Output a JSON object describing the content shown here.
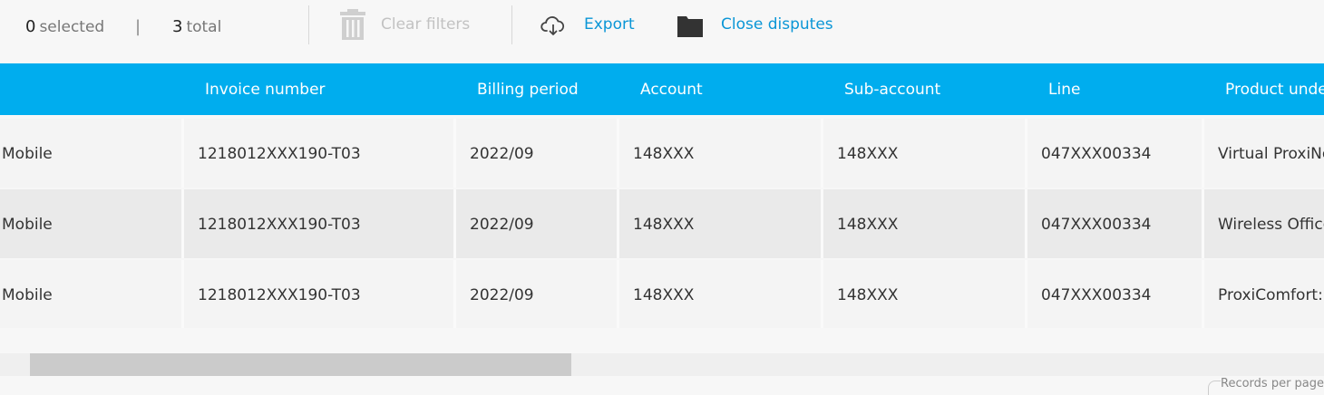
{
  "toolbar": {
    "selected_count": "0",
    "selected_label": "selected",
    "separator": "|",
    "total_count": "3",
    "total_label": "total",
    "clear_filters_label": "Clear filters",
    "export_label": "Export",
    "close_disputes_label": "Close disputes",
    "icons": {
      "clear": "trash-icon",
      "export": "cloud-download-icon",
      "close": "folder-icon"
    }
  },
  "table": {
    "columns": [
      "",
      "Invoice number",
      "Billing period",
      "Account",
      "Sub-account",
      "Line",
      "Product unde"
    ],
    "rows": [
      [
        "Mobile",
        "1218012XXX190-T03",
        "2022/09",
        "148XXX",
        "148XXX",
        "047XXX00334",
        "Virtual ProxiNe"
      ],
      [
        "Mobile",
        "1218012XXX190-T03",
        "2022/09",
        "148XXX",
        "148XXX",
        "047XXX00334",
        "Wireless Office"
      ],
      [
        "Mobile",
        "1218012XXX190-T03",
        "2022/09",
        "148XXX",
        "148XXX",
        "047XXX00334",
        "ProxiComfort:"
      ]
    ],
    "header_bg": "#00adee"
  },
  "footer": {
    "records_per_page_label": "Records per page"
  },
  "colors": {
    "accent": "#0a96d6",
    "row_odd": "#f4f4f4",
    "row_even": "#eaeaea",
    "disabled": "#c2c2c2"
  }
}
